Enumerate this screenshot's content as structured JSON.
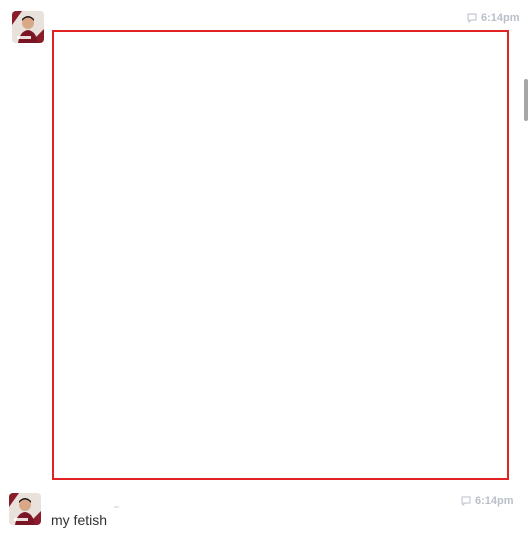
{
  "messages": [
    {
      "avatar": "user-avatar",
      "timestamp": "6:14pm",
      "icon": "comment-icon",
      "attachment": "image"
    },
    {
      "avatar": "user-avatar",
      "timestamp": "6:14pm",
      "icon": "comment-icon",
      "text": "my fetish"
    }
  ],
  "colors": {
    "frame_border": "#e02222",
    "timestamp": "#b9c0c8",
    "text": "#2f3133"
  }
}
